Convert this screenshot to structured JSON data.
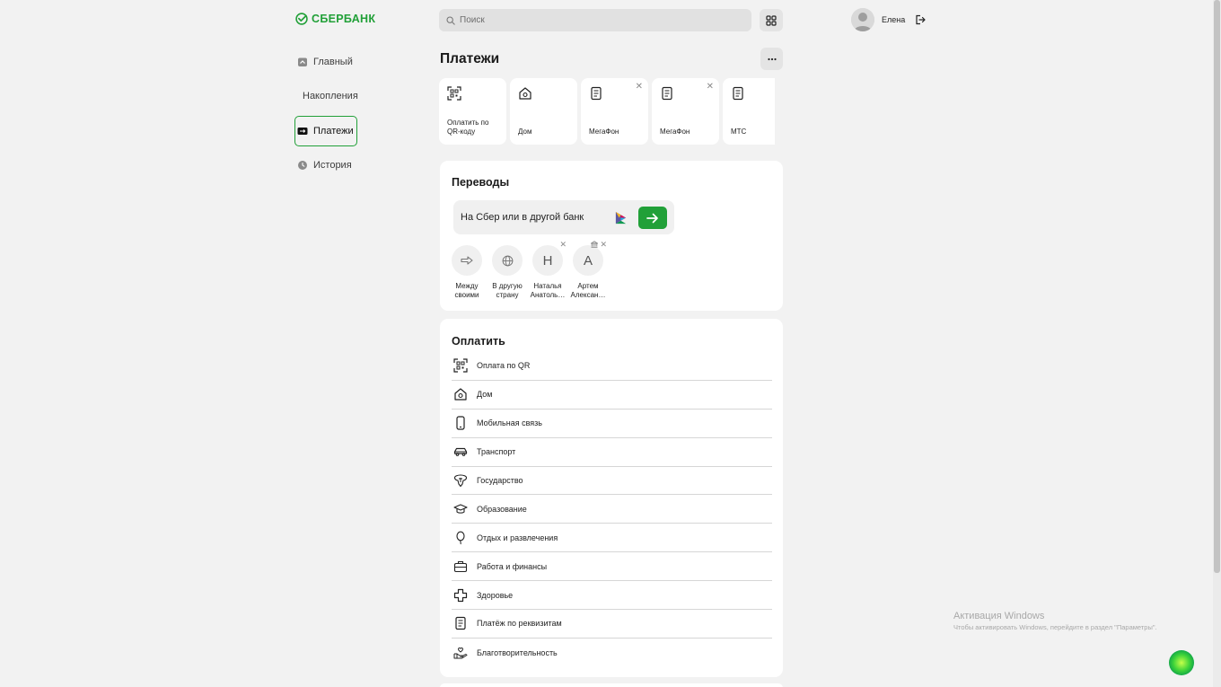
{
  "brand": {
    "name": "СБЕРБАНК",
    "color": "#21a038"
  },
  "search": {
    "placeholder": "Поиск"
  },
  "user": {
    "name": "Елена"
  },
  "sidebar": {
    "items": [
      {
        "label": "Главный",
        "icon": "home-icon",
        "active": false
      },
      {
        "label": "Накопления",
        "icon": "chart-icon",
        "active": false
      },
      {
        "label": "Платежи",
        "icon": "payment-icon",
        "active": true
      },
      {
        "label": "История",
        "icon": "clock-icon",
        "active": false
      }
    ]
  },
  "page": {
    "title": "Платежи"
  },
  "quick_tiles": [
    {
      "label": "Оплатить по QR-коду",
      "icon": "qr-scan-icon",
      "closable": false
    },
    {
      "label": "Дом",
      "icon": "house-icon",
      "closable": false
    },
    {
      "label": "МегаФон",
      "icon": "receipt-icon",
      "closable": true
    },
    {
      "label": "МегаФон",
      "icon": "receipt-icon",
      "closable": true
    },
    {
      "label": "МТС",
      "icon": "receipt-icon",
      "closable": false
    }
  ],
  "transfers": {
    "title": "Переводы",
    "input_label": "На Сбер или в другой банк",
    "recipients": [
      {
        "label": "Между своими",
        "initial": "",
        "icon": "swap-arrow-icon",
        "closable": false
      },
      {
        "label": "В другую страну",
        "initial": "",
        "icon": "globe-icon",
        "closable": false
      },
      {
        "label": "Наталья Анатоль…",
        "initial": "Н",
        "icon": "",
        "closable": true
      },
      {
        "label": "Артем Алексан…",
        "initial": "А",
        "icon": "",
        "closable": true
      }
    ]
  },
  "pay": {
    "title": "Оплатить",
    "items": [
      {
        "label": "Оплата по QR",
        "icon": "qr-scan-icon"
      },
      {
        "label": "Дом",
        "icon": "house-icon"
      },
      {
        "label": "Мобильная связь",
        "icon": "phone-icon"
      },
      {
        "label": "Транспорт",
        "icon": "car-icon"
      },
      {
        "label": "Государство",
        "icon": "emblem-icon"
      },
      {
        "label": "Образование",
        "icon": "graduation-cap-icon"
      },
      {
        "label": "Отдых и развлечения",
        "icon": "balloon-icon"
      },
      {
        "label": "Работа и финансы",
        "icon": "briefcase-icon"
      },
      {
        "label": "Здоровье",
        "icon": "health-cross-icon"
      },
      {
        "label": "Платёж по реквизитам",
        "icon": "document-icon"
      },
      {
        "label": "Благотворительность",
        "icon": "charity-hand-icon"
      }
    ]
  },
  "watermark": {
    "line1": "Активация Windows",
    "line2": "Чтобы активировать Windows, перейдите в раздел \"Параметры\"."
  }
}
